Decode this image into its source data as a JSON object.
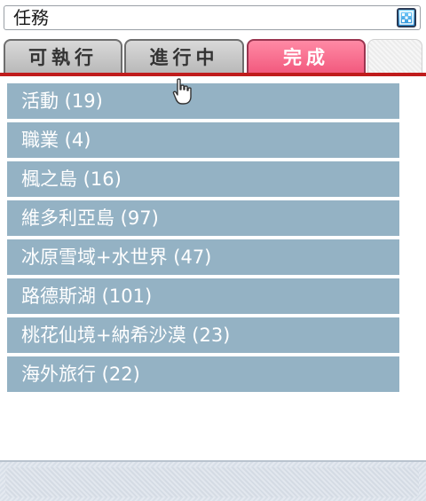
{
  "window": {
    "title": "任務"
  },
  "tabs": [
    {
      "label": "可執行",
      "active": false
    },
    {
      "label": "進行中",
      "active": false
    },
    {
      "label": "完成",
      "active": true
    }
  ],
  "quest_categories": [
    {
      "label": "活動 (19)"
    },
    {
      "label": "職業 (4)"
    },
    {
      "label": "楓之島 (16)"
    },
    {
      "label": "維多利亞島 (97)"
    },
    {
      "label": "冰原雪域+水世界 (47)"
    },
    {
      "label": "路德斯湖 (101)"
    },
    {
      "label": "桃花仙境+納希沙漠 (23)"
    },
    {
      "label": "海外旅行 (22)"
    }
  ],
  "colors": {
    "active_tab": "#f25a7e",
    "tab_underline": "#c01c1c",
    "list_item_bg": "#94b2c4"
  },
  "icons": {
    "close": "close-icon",
    "cursor": "hand-cursor-icon"
  }
}
